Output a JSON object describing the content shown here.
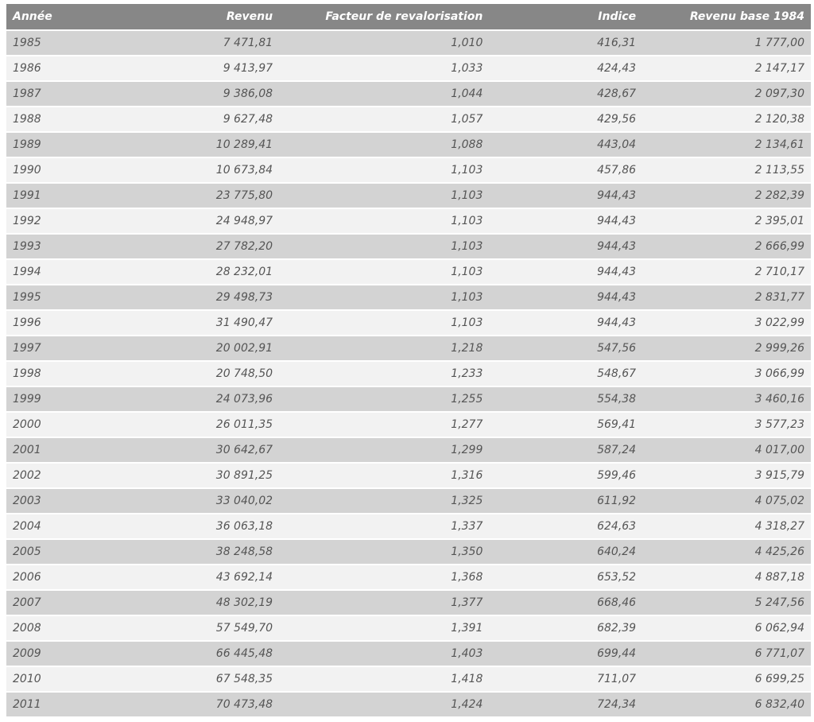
{
  "table": {
    "headers": [
      "Année",
      "Revenu",
      "Facteur de revalorisation",
      "Indice",
      "Revenu base 1984"
    ],
    "rows": [
      [
        "1985",
        "7 471,81",
        "1,010",
        "416,31",
        "1 777,00"
      ],
      [
        "1986",
        "9 413,97",
        "1,033",
        "424,43",
        "2 147,17"
      ],
      [
        "1987",
        "9 386,08",
        "1,044",
        "428,67",
        "2 097,30"
      ],
      [
        "1988",
        "9 627,48",
        "1,057",
        "429,56",
        "2 120,38"
      ],
      [
        "1989",
        "10 289,41",
        "1,088",
        "443,04",
        "2 134,61"
      ],
      [
        "1990",
        "10 673,84",
        "1,103",
        "457,86",
        "2 113,55"
      ],
      [
        "1991",
        "23 775,80",
        "1,103",
        "944,43",
        "2 282,39"
      ],
      [
        "1992",
        "24 948,97",
        "1,103",
        "944,43",
        "2 395,01"
      ],
      [
        "1993",
        "27 782,20",
        "1,103",
        "944,43",
        "2 666,99"
      ],
      [
        "1994",
        "28 232,01",
        "1,103",
        "944,43",
        "2 710,17"
      ],
      [
        "1995",
        "29 498,73",
        "1,103",
        "944,43",
        "2 831,77"
      ],
      [
        "1996",
        "31 490,47",
        "1,103",
        "944,43",
        "3 022,99"
      ],
      [
        "1997",
        "20 002,91",
        "1,218",
        "547,56",
        "2 999,26"
      ],
      [
        "1998",
        "20 748,50",
        "1,233",
        "548,67",
        "3 066,99"
      ],
      [
        "1999",
        "24 073,96",
        "1,255",
        "554,38",
        "3 460,16"
      ],
      [
        "2000",
        "26 011,35",
        "1,277",
        "569,41",
        "3 577,23"
      ],
      [
        "2001",
        "30 642,67",
        "1,299",
        "587,24",
        "4 017,00"
      ],
      [
        "2002",
        "30 891,25",
        "1,316",
        "599,46",
        "3 915,79"
      ],
      [
        "2003",
        "33 040,02",
        "1,325",
        "611,92",
        "4 075,02"
      ],
      [
        "2004",
        "36 063,18",
        "1,337",
        "624,63",
        "4 318,27"
      ],
      [
        "2005",
        "38 248,58",
        "1,350",
        "640,24",
        "4 425,26"
      ],
      [
        "2006",
        "43 692,14",
        "1,368",
        "653,52",
        "4 887,18"
      ],
      [
        "2007",
        "48 302,19",
        "1,377",
        "668,46",
        "5 247,56"
      ],
      [
        "2008",
        "57 549,70",
        "1,391",
        "682,39",
        "6 062,94"
      ],
      [
        "2009",
        "66 445,48",
        "1,403",
        "699,44",
        "6 771,07"
      ],
      [
        "2010",
        "67 548,35",
        "1,418",
        "711,07",
        "6 699,25"
      ],
      [
        "2011",
        "70 473,48",
        "1,424",
        "724,34",
        "6 832,40"
      ]
    ]
  },
  "colors": {
    "header_bg": "#878787",
    "row_odd_bg": "#d3d3d3",
    "row_even_bg": "#f2f2f2",
    "text": "#555555"
  }
}
